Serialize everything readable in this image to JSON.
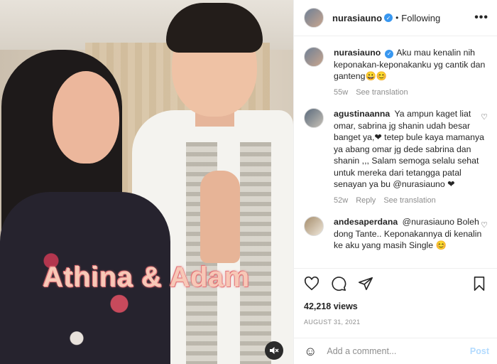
{
  "post": {
    "overlay_text": "Athina & Adam",
    "username": "nurasiauno",
    "follow_status": "Following",
    "more_label": "•••"
  },
  "caption": {
    "username": "nurasiauno",
    "text": "Aku mau kenalin nih keponakan-keponakanku yg cantik dan ganteng😀😊",
    "age": "55w",
    "translation": "See translation"
  },
  "comments": [
    {
      "username": "agustinaanna",
      "text": "Ya ampun kaget liat omar, sabrina jg shanin udah besar banget ya,❤ tetep bule kaya mamanya ya abang omar jg dede sabrina dan shanin ,,, Salam semoga selalu sehat untuk mereka dari tetangga patal senayan ya bu @nurasiauno ❤",
      "age": "52w",
      "reply": "Reply",
      "translation": "See translation"
    },
    {
      "username": "andesaperdana",
      "text": "@nurasiauno Boleh dong Tante.. Keponakannya di kenalin ke aku yang masih Single 😊",
      "age": "",
      "reply": "",
      "translation": ""
    }
  ],
  "stats": {
    "views": "42,218 views",
    "date": "AUGUST 31, 2021"
  },
  "composer": {
    "placeholder": "Add a comment...",
    "post_label": "Post"
  },
  "icons": {
    "like": "heart-icon",
    "comment": "comment-icon",
    "share": "share-icon",
    "save": "bookmark-icon",
    "emoji": "emoji-icon",
    "mute": "muted-speaker-icon"
  },
  "colors": {
    "verified": "#3897f0",
    "post_disabled": "#b3dbff",
    "muted_text": "#8e8e8e"
  }
}
